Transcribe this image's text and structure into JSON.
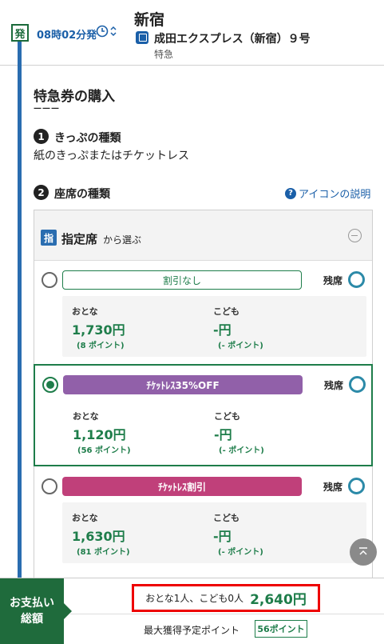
{
  "header": {
    "departure_badge": "発",
    "departure_time": "08時02分発",
    "station": "新宿",
    "train_name": "成田エクスプレス（新宿）９号",
    "train_type": "特急"
  },
  "section": {
    "title": "特急券の購入",
    "dashes": "———"
  },
  "step1": {
    "number": "1",
    "label": "きっぷの種類",
    "value": "紙のきっぷまたはチケットレス"
  },
  "step2": {
    "number": "2",
    "label": "座席の種類",
    "help_link": "アイコンの説明",
    "help_icon": "?"
  },
  "seat_panel": {
    "badge": "指",
    "title": "指定席",
    "subtitle": "から選ぶ",
    "options": [
      {
        "label": "割引なし",
        "selected": false,
        "remain_label": "残席",
        "adult_label": "おとな",
        "adult_price": "1,730円",
        "adult_points": "(8 ポイント)",
        "child_label": "こども",
        "child_price": "-円",
        "child_points": "(- ポイント)"
      },
      {
        "label": "ﾁｹｯﾄﾚｽ35%OFF",
        "selected": true,
        "remain_label": "残席",
        "adult_label": "おとな",
        "adult_price": "1,120円",
        "adult_points": "(56 ポイント)",
        "child_label": "こども",
        "child_price": "-円",
        "child_points": "(- ポイント)"
      },
      {
        "label": "ﾁｹｯﾄﾚｽ割引",
        "selected": false,
        "remain_label": "残席",
        "adult_label": "おとな",
        "adult_price": "1,630円",
        "adult_points": "(81 ポイント)",
        "child_label": "こども",
        "child_price": "-円",
        "child_points": "(- ポイント)"
      }
    ]
  },
  "footer": {
    "pay_label_line1": "お支払い",
    "pay_label_line2": "総額",
    "persons": "おとな1人、こども0人",
    "total": "2,640円",
    "points_label": "最大獲得予定ポイント",
    "points_value": "56ポイント"
  },
  "colors": {
    "accent_green": "#1e7d4a",
    "timeline_blue": "#2a6db0",
    "link_blue": "#1a5fa8",
    "purple": "#9160a9",
    "magenta": "#c0407a",
    "highlight_red": "#e00000"
  }
}
